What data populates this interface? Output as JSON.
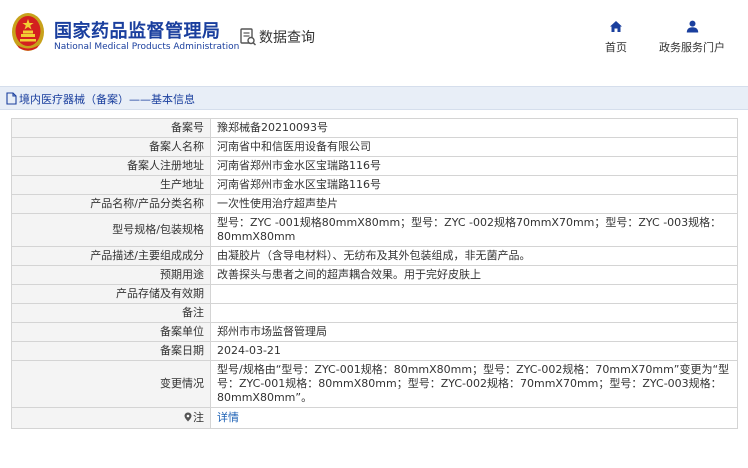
{
  "header": {
    "org_name_cn": "国家药品监督管理局",
    "org_name_en": "National Medical Products Administration",
    "emblem_icon": "national-emblem-icon",
    "data_query_label": "数据查询",
    "nav": {
      "home_label": "首页",
      "portal_label": "政务服务门户"
    },
    "brand_color": "#1a3f9e"
  },
  "section": {
    "title": "境内医疗器械（备案）——基本信息"
  },
  "record": {
    "rows": [
      {
        "label": "备案号",
        "value": "豫郑械备20210093号"
      },
      {
        "label": "备案人名称",
        "value": "河南省中和信医用设备有限公司"
      },
      {
        "label": "备案人注册地址",
        "value": "河南省郑州市金水区宝瑞路116号"
      },
      {
        "label": "生产地址",
        "value": "河南省郑州市金水区宝瑞路116号"
      },
      {
        "label": "产品名称/产品分类名称",
        "value": "一次性使用治疗超声垫片"
      },
      {
        "label": "型号规格/包装规格",
        "value": "型号：ZYC -001规格80mmX80mm；型号：ZYC -002规格70mmX70mm；型号：ZYC -003规格：80mmX80mm"
      },
      {
        "label": "产品描述/主要组成成分",
        "value": "由凝胶片（含导电材料）、无纺布及其外包装组成，非无菌产品。"
      },
      {
        "label": "预期用途",
        "value": "改善探头与患者之间的超声耦合效果。用于完好皮肤上"
      },
      {
        "label": "产品存储及有效期",
        "value": ""
      },
      {
        "label": "备注",
        "value": ""
      },
      {
        "label": "备案单位",
        "value": "郑州市市场监督管理局"
      },
      {
        "label": "备案日期",
        "value": "2024-03-21"
      },
      {
        "label": "变更情况",
        "value": "型号/规格由“型号：ZYC-001规格：80mmX80mm；型号：ZYC-002规格：70mmX70mm”变更为“型号：ZYC-001规格：80mmX80mm；型号：ZYC-002规格：70mmX70mm；型号：ZYC-003规格：80mmX80mm”。"
      }
    ],
    "note_label": "注",
    "detail_link": "详情"
  }
}
